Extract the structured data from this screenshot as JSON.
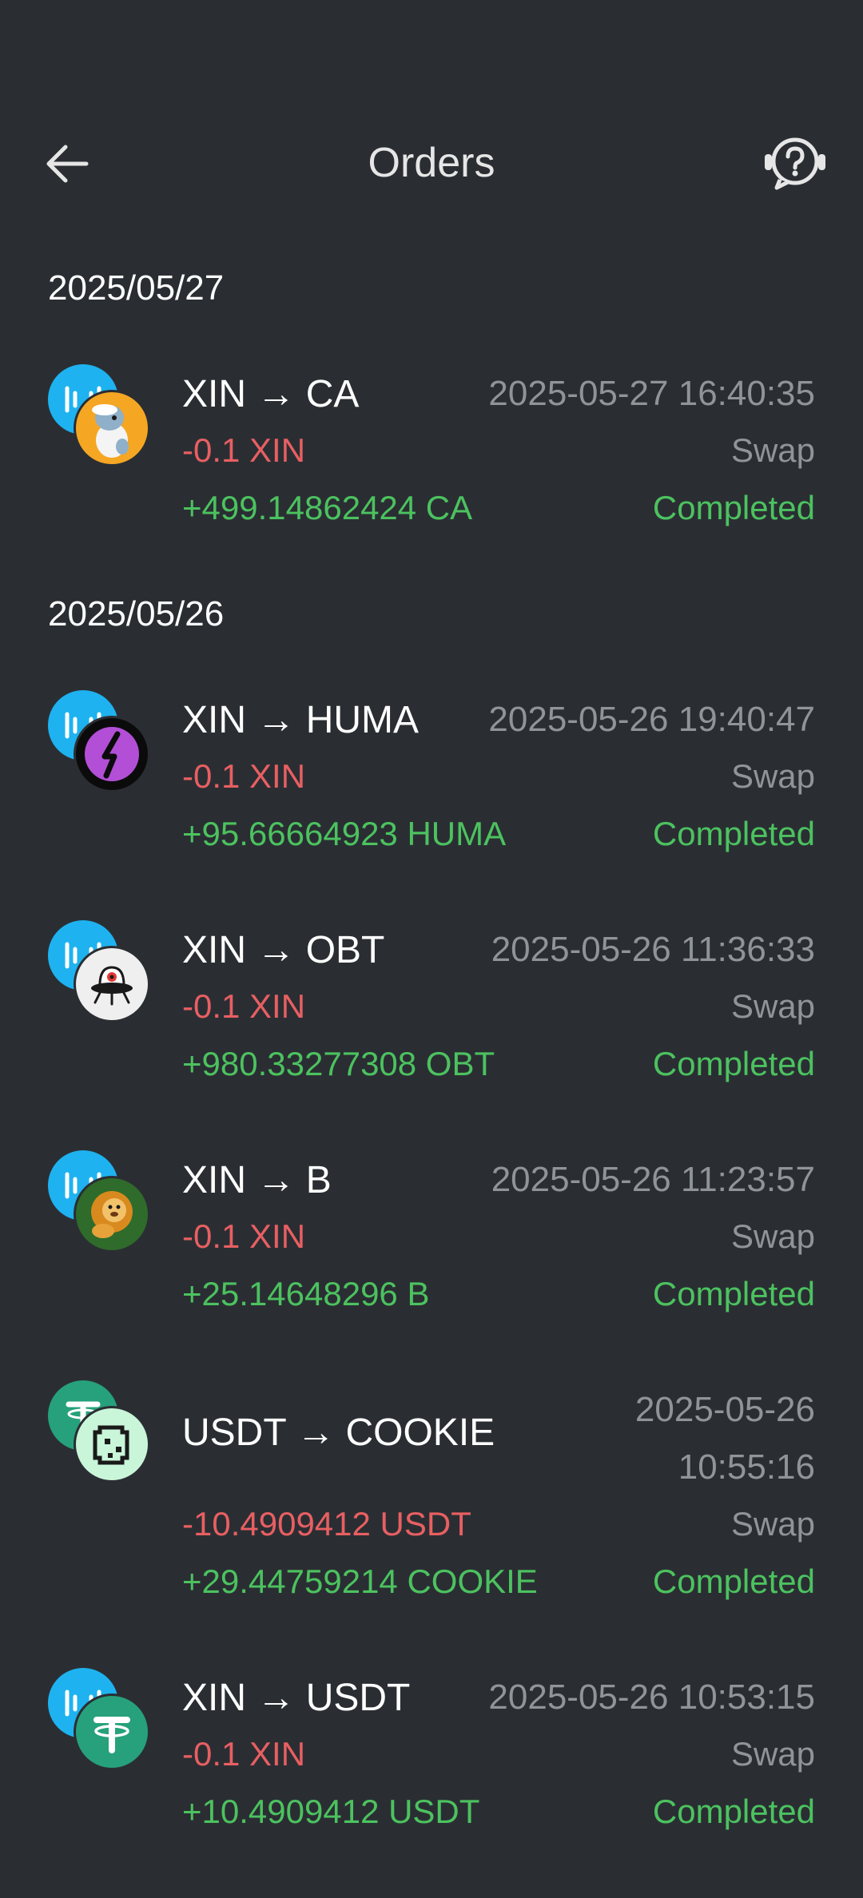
{
  "header": {
    "title": "Orders"
  },
  "groups": [
    {
      "date": "2025/05/27",
      "orders": [
        {
          "pair": "XIN → CA",
          "time": "2025-05-27 16:40:35",
          "out": "-0.1 XIN",
          "in": "+499.14862424 CA",
          "type": "Swap",
          "status": "Completed",
          "from_icon": "mixin-logo-icon",
          "to_icon": "ca-token-icon"
        }
      ]
    },
    {
      "date": "2025/05/26",
      "orders": [
        {
          "pair": "XIN → HUMA",
          "time": "2025-05-26 19:40:47",
          "out": "-0.1 XIN",
          "in": "+95.66664923 HUMA",
          "type": "Swap",
          "status": "Completed",
          "from_icon": "mixin-logo-icon",
          "to_icon": "huma-token-icon"
        },
        {
          "pair": "XIN → OBT",
          "time": "2025-05-26 11:36:33",
          "out": "-0.1 XIN",
          "in": "+980.33277308 OBT",
          "type": "Swap",
          "status": "Completed",
          "from_icon": "mixin-logo-icon",
          "to_icon": "obt-token-icon"
        },
        {
          "pair": "XIN → B",
          "time": "2025-05-26 11:23:57",
          "out": "-0.1 XIN",
          "in": "+25.14648296 B",
          "type": "Swap",
          "status": "Completed",
          "from_icon": "mixin-logo-icon",
          "to_icon": "b-token-icon"
        },
        {
          "pair": "USDT → COOKIE",
          "time_date": "2025-05-26",
          "time_clock": "10:55:16",
          "out": "-10.4909412 USDT",
          "in": "+29.44759214 COOKIE",
          "type": "Swap",
          "status": "Completed",
          "from_icon": "tether-logo-icon",
          "to_icon": "cookie-token-icon"
        },
        {
          "pair": "XIN → USDT",
          "time": "2025-05-26 10:53:15",
          "out": "-0.1 XIN",
          "in": "+10.4909412 USDT",
          "type": "Swap",
          "status": "Completed",
          "from_icon": "mixin-logo-icon",
          "to_icon": "tether-logo-icon"
        }
      ]
    }
  ],
  "colors": {
    "background": "#2a2e33",
    "negative": "#e85f62",
    "positive": "#4cc25f",
    "muted": "#8f9499",
    "mixin_blue": "#1eb2f0",
    "tether_green": "#26a17b"
  }
}
